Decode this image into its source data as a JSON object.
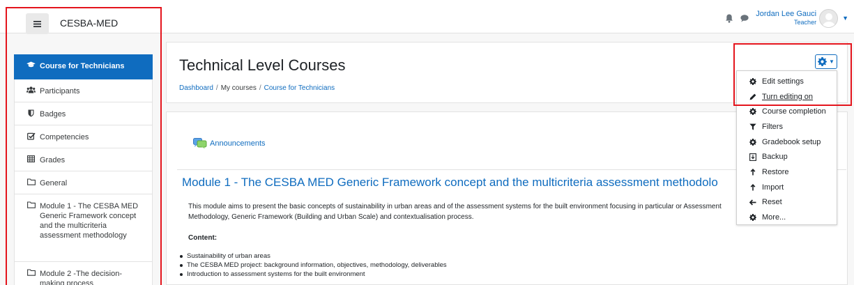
{
  "site_name": "CESBA-MED",
  "user": {
    "name": "Jordan Lee Gauci",
    "role": "Teacher"
  },
  "sidebar": {
    "items": [
      {
        "label": "Course for Technicians",
        "icon": "graduation-cap-icon",
        "active": true
      },
      {
        "label": "Participants",
        "icon": "users-icon"
      },
      {
        "label": "Badges",
        "icon": "shield-icon"
      },
      {
        "label": "Competencies",
        "icon": "checkbox-icon"
      },
      {
        "label": "Grades",
        "icon": "table-icon"
      },
      {
        "label": "General",
        "icon": "folder-icon"
      },
      {
        "label": "Module 1 - The CESBA MED Generic Framework concept and the multicriteria assessment methodology",
        "icon": "folder-icon"
      },
      {
        "label": "Module 2 -The decision-making process",
        "icon": "folder-icon"
      }
    ]
  },
  "header": {
    "title": "Technical Level Courses",
    "breadcrumb": [
      "Dashboard",
      "My courses",
      "Course for Technicians"
    ],
    "breadcrumb_separator": "/"
  },
  "menu": {
    "items": [
      {
        "label": "Edit settings",
        "icon": "gear-icon"
      },
      {
        "label": "Turn editing on",
        "icon": "pencil-icon"
      },
      {
        "label": "Course completion",
        "icon": "gear-icon"
      },
      {
        "label": "Filters",
        "icon": "filter-icon"
      },
      {
        "label": "Gradebook setup",
        "icon": "gear-icon"
      },
      {
        "label": "Backup",
        "icon": "backup-icon"
      },
      {
        "label": "Restore",
        "icon": "restore-icon"
      },
      {
        "label": "Import",
        "icon": "import-icon"
      },
      {
        "label": "Reset",
        "icon": "arrow-left-icon"
      },
      {
        "label": "More...",
        "icon": "gear-icon"
      }
    ]
  },
  "content": {
    "announcements_label": "Announcements",
    "module_title": "Module 1 - The CESBA MED Generic Framework concept and the multicriteria assessment methodolo",
    "description": "This module aims to present the basic concepts of sustainability in urban areas and of the assessment systems for the built environment focusing in particular or Assessment Methodology, Generic Framework (Building and Urban Scale) and contextualisation process.",
    "content_label": "Content:",
    "bullets": [
      "Sustainability of urban areas",
      "The CESBA MED project: background information, objectives, methodology, deliverables",
      "Introduction to assessment systems for the built environment"
    ]
  },
  "colors": {
    "accent": "#0f6cbf",
    "highlight": "#e4141c",
    "sidebar_active": "#0f6cbf"
  }
}
